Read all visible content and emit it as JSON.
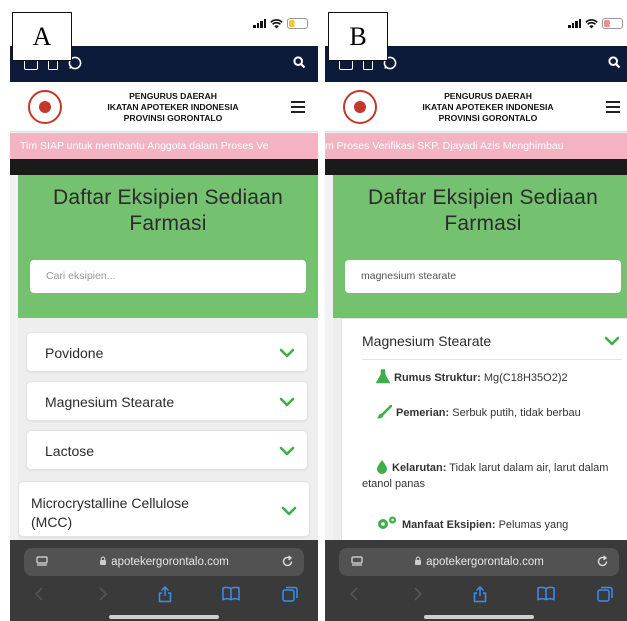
{
  "panels": [
    {
      "label": "A",
      "battery": "20",
      "battery_color": "#f5c542",
      "org": [
        "PENGURUS DAERAH",
        "IKATAN APOTEKER INDONESIA",
        "PROVINSI GORONTALO"
      ],
      "ticker": "Tim SIAP untuk membantu Anggota dalam Proses Ve",
      "title_line1": "Daftar Eksipien Sediaan",
      "title_line2": "Farmasi",
      "search_placeholder": "Cari eksipien...",
      "search_value": "",
      "items": [
        {
          "name": "Povidone"
        },
        {
          "name": "Magnesium Stearate"
        },
        {
          "name": "Lactose"
        },
        {
          "name_line1": "Microcrystalline Cellulose",
          "name_line2": "(MCC)"
        }
      ],
      "url": "apotekergorontalo.com"
    },
    {
      "label": "B",
      "battery": "19",
      "battery_color": "#f28b8b",
      "org": [
        "PENGURUS DAERAH",
        "IKATAN APOTEKER INDONESIA",
        "PROVINSI GORONTALO"
      ],
      "ticker": "m Proses Verifikasi SKP. Djayadi Azis Menghimbau",
      "title_line1": "Daftar Eksipien Sediaan",
      "title_line2": "Farmasi",
      "search_value": "magnesium stearate",
      "detail": {
        "title": "Magnesium Stearate",
        "props": [
          {
            "label": "Rumus Struktur:",
            "value": "Mg(C18H35O2)2",
            "icon": "flask-icon"
          },
          {
            "label": "Pemerian:",
            "value": "Serbuk putih, tidak berbau",
            "icon": "brush-icon"
          },
          {
            "label": "Kelarutan:",
            "value": "Tidak larut dalam air, larut dalam etanol panas",
            "icon": "droplet-icon"
          },
          {
            "label": "Manfaat Eksipien:",
            "value": "Pelumas yang",
            "icon": "gears-icon"
          }
        ]
      },
      "url": "apotekergorontalo.com"
    }
  ],
  "colors": {
    "accent_green": "#74c270",
    "navy": "#0d1b3a",
    "ticker_pink": "#f4b3c2",
    "chevron_green": "#3fae49",
    "icon_green": "#3fae49"
  }
}
